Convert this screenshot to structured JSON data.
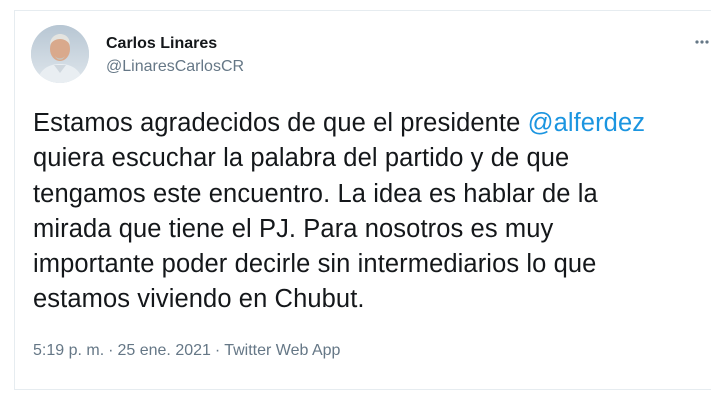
{
  "tweet": {
    "author_name": "Carlos Linares",
    "author_handle": "@LinaresCarlosCR",
    "text_lines": [
      {
        "before": "Estamos agradecidos de que el presidente ",
        "mention": "@alferdez"
      },
      {
        "before": "quiera escuchar la palabra del partido y de que"
      },
      {
        "before": "tengamos este encuentro. La idea es hablar de la"
      },
      {
        "before": "mirada que tiene el PJ. Para nosotros es muy"
      },
      {
        "before": "importante poder decirle sin intermediarios lo que"
      },
      {
        "before": "estamos viviendo en Chubut."
      }
    ],
    "time": "5:19 p. m.",
    "separator": "·",
    "date": "25 ene. 2021",
    "source": "Twitter Web App"
  },
  "icons": {
    "more": "more-options-icon",
    "avatar": "profile-photo"
  },
  "colors": {
    "mention": "#1b95e0",
    "text": "#14171a",
    "secondary": "#657786",
    "border": "#e6ecf0"
  }
}
